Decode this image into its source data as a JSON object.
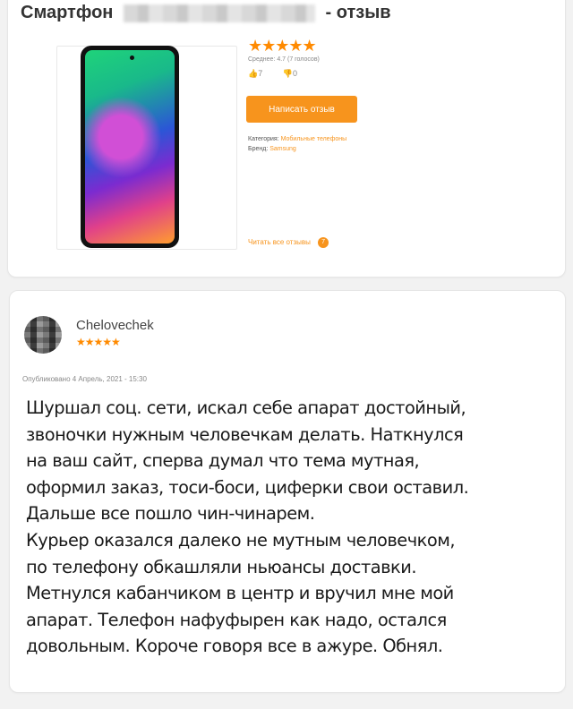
{
  "product": {
    "title_prefix": "Смартфон",
    "title_suffix": "- отзыв",
    "rating_stars": "★★★★★",
    "average": "Среднее: 4.7  (7 голосов)",
    "likes": "7",
    "dislikes": "0",
    "write_review_label": "Написать отзыв",
    "category_label": "Категория:",
    "category_value": "Мобильные телефоны",
    "brand_label": "Бренд:",
    "brand_value": "Samsung",
    "read_all_label": "Читать все отзывы",
    "review_count": "7"
  },
  "review": {
    "author": "Chelovechek",
    "stars": "★★★★★",
    "published": "Опубликовано 4 Апрель, 2021 - 15:30",
    "lines": [
      "Шуршал соц. сети, искал себе апарат достойный,",
      "звоночки нужным человечкам делать. Наткнулся",
      "на ваш сайт, сперва думал что тема мутная,",
      "оформил заказ, тоси-боси, циферки свои оставил.",
      "Дальше все пошло чин-чинарем.",
      "Курьер оказался далеко не мутным человечком,",
      "по телефону обкашляли ньюансы доставки.",
      "Метнулся кабанчиком в центр и вручил мне мой",
      "апарат. Телефон нафуфырен как надо, остался",
      "довольным. Короче говоря все в ажуре. Обнял."
    ]
  },
  "colors": {
    "accent": "#f7941d",
    "star": "#ff8a00"
  }
}
